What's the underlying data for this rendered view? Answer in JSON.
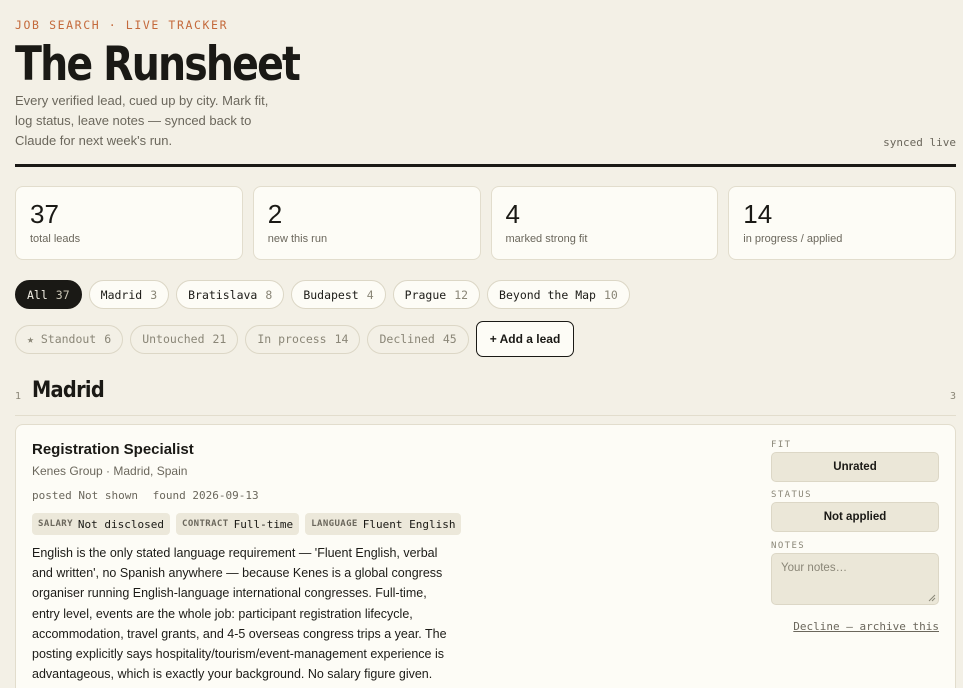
{
  "header": {
    "eyebrow": "JOB SEARCH · LIVE TRACKER",
    "title": "The Runsheet",
    "subtitle": "Every verified lead, cued up by city. Mark fit, log status, leave notes — synced back to Claude for next week's run.",
    "sync_status": "synced live"
  },
  "stats": [
    {
      "value": "37",
      "label": "total leads"
    },
    {
      "value": "2",
      "label": "new this run"
    },
    {
      "value": "4",
      "label": "marked strong fit"
    },
    {
      "value": "14",
      "label": "in progress / applied"
    }
  ],
  "city_filters": [
    {
      "label": "All",
      "count": "37",
      "active": true
    },
    {
      "label": "Madrid",
      "count": "3"
    },
    {
      "label": "Bratislava",
      "count": "8"
    },
    {
      "label": "Budapest",
      "count": "4"
    },
    {
      "label": "Prague",
      "count": "12"
    },
    {
      "label": "Beyond the Map",
      "count": "10"
    }
  ],
  "status_filters": [
    {
      "label": "★ Standout",
      "count": "6"
    },
    {
      "label": "Untouched",
      "count": "21"
    },
    {
      "label": "In process",
      "count": "14"
    },
    {
      "label": "Declined",
      "count": "45"
    }
  ],
  "add_lead_label": "+ Add a lead",
  "section": {
    "index": "1",
    "title": "Madrid",
    "count": "3"
  },
  "lead": {
    "title": "Registration Specialist",
    "company": "Kenes Group · Madrid, Spain",
    "posted_label": "posted",
    "posted_value": "Not shown",
    "found_label": "found",
    "found_value": "2026-09-13",
    "tags": [
      {
        "key": "SALARY",
        "value": "Not disclosed"
      },
      {
        "key": "CONTRACT",
        "value": "Full-time"
      },
      {
        "key": "LANGUAGE",
        "value": "Fluent English"
      }
    ],
    "description": "English is the only stated language requirement — 'Fluent English, verbal and written', no Spanish anywhere — because Kenes is a global congress organiser running English-language international congresses. Full-time, entry level, events are the whole job: participant registration lifecycle, accommodation, travel grants, and 4-5 overseas congress trips a year. The posting explicitly says hospitality/tourism/event-management experience is advantageous, which is exactly your background. No salary figure given.",
    "fit_label": "FIT",
    "fit_value": "Unrated",
    "status_label": "STATUS",
    "status_value": "Not applied",
    "notes_label": "NOTES",
    "notes_placeholder": "Your notes…",
    "decline_label": "Decline — archive this"
  }
}
